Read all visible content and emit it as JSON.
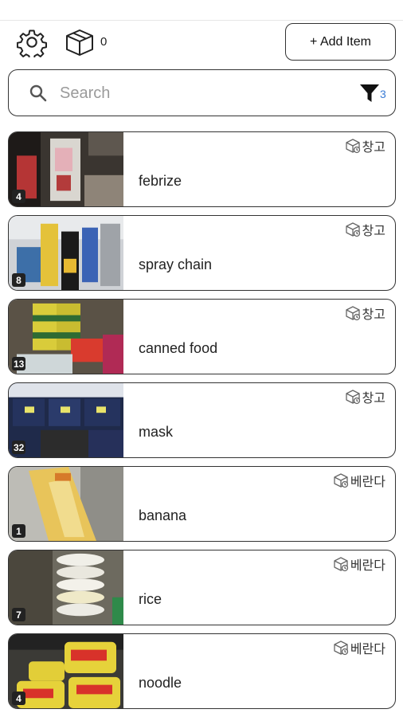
{
  "toolbar": {
    "box_count": "0",
    "add_item_label": "+ Add Item"
  },
  "search": {
    "placeholder": "Search",
    "value": "",
    "filter_count": "3"
  },
  "items": [
    {
      "name": "febrize",
      "count": "4",
      "location": "창고"
    },
    {
      "name": "spray chain",
      "count": "8",
      "location": "창고"
    },
    {
      "name": "canned food",
      "count": "13",
      "location": "창고"
    },
    {
      "name": "mask",
      "count": "32",
      "location": "창고"
    },
    {
      "name": "banana",
      "count": "1",
      "location": "베란다"
    },
    {
      "name": "rice",
      "count": "7",
      "location": "베란다"
    },
    {
      "name": "noodle",
      "count": "4",
      "location": "베란다"
    }
  ]
}
